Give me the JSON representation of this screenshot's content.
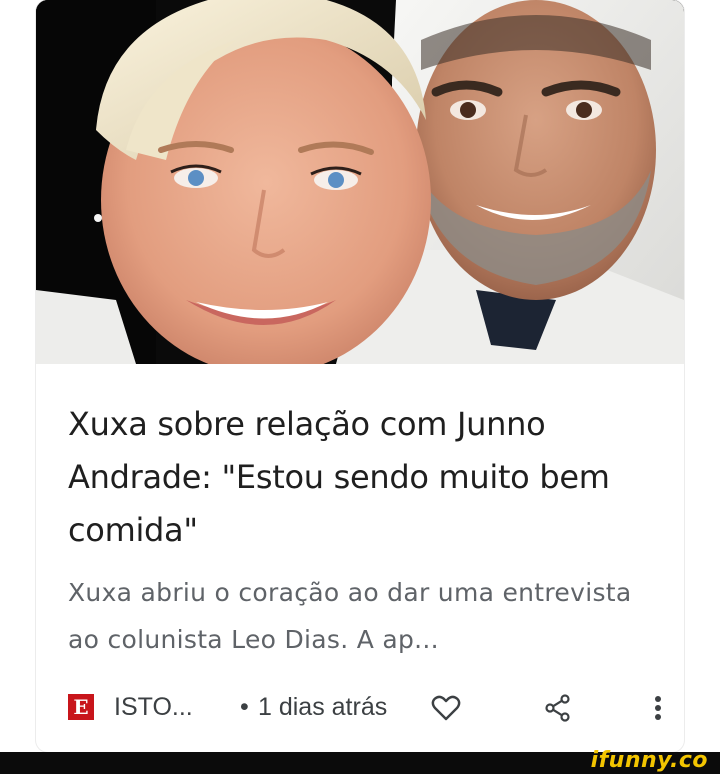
{
  "article": {
    "title": "Xuxa sobre relação com Junno Andrade: \"Estou sendo muito bem comida\"",
    "snippet": "Xuxa abriu o coração ao dar uma entrevista ao colunista Leo Dias. A ap..."
  },
  "source": {
    "logo_letter": "E",
    "name": "ISTO...",
    "separator": "•",
    "time": "1 dias atrás"
  },
  "actions": {
    "like_icon": "heart-outline",
    "share_icon": "share",
    "more_icon": "more-vertical"
  },
  "watermark": {
    "text": "ifunny.co",
    "color": "#f3c500"
  },
  "colors": {
    "title": "#1f1f1f",
    "snippet": "#5f6368",
    "source_logo": "#c8151b"
  }
}
